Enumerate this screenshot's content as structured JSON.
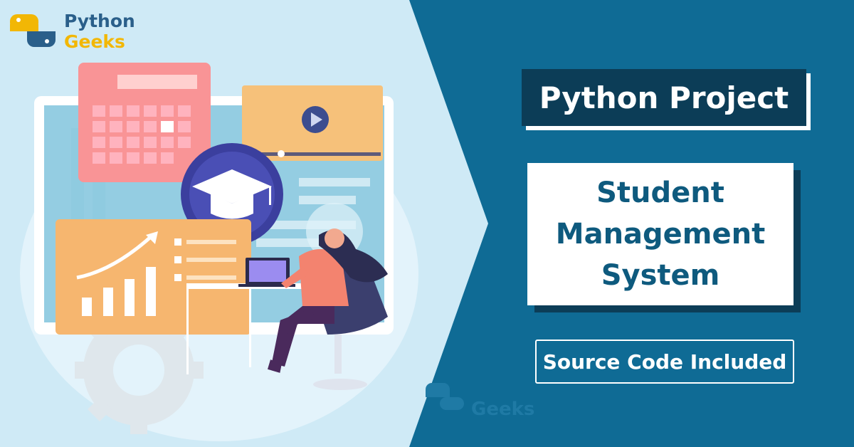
{
  "brand": {
    "name_line1": "Python",
    "name_line2": "Geeks",
    "colors": {
      "blue": "#2a5f8a",
      "yellow": "#f2b705"
    }
  },
  "banner": {
    "title": "Python Project",
    "subject_lines": [
      "Student",
      "Management",
      "System"
    ],
    "tagline": "Source Code Included"
  },
  "watermark": {
    "text": "Geeks"
  },
  "illustration": {
    "icons": [
      "calendar-icon",
      "video-player-icon",
      "graduation-cap-icon",
      "growth-chart-icon",
      "laptop-icon",
      "gear-icon"
    ],
    "background_color": "#cfeaf6",
    "accent_color": "#0f6b95"
  }
}
